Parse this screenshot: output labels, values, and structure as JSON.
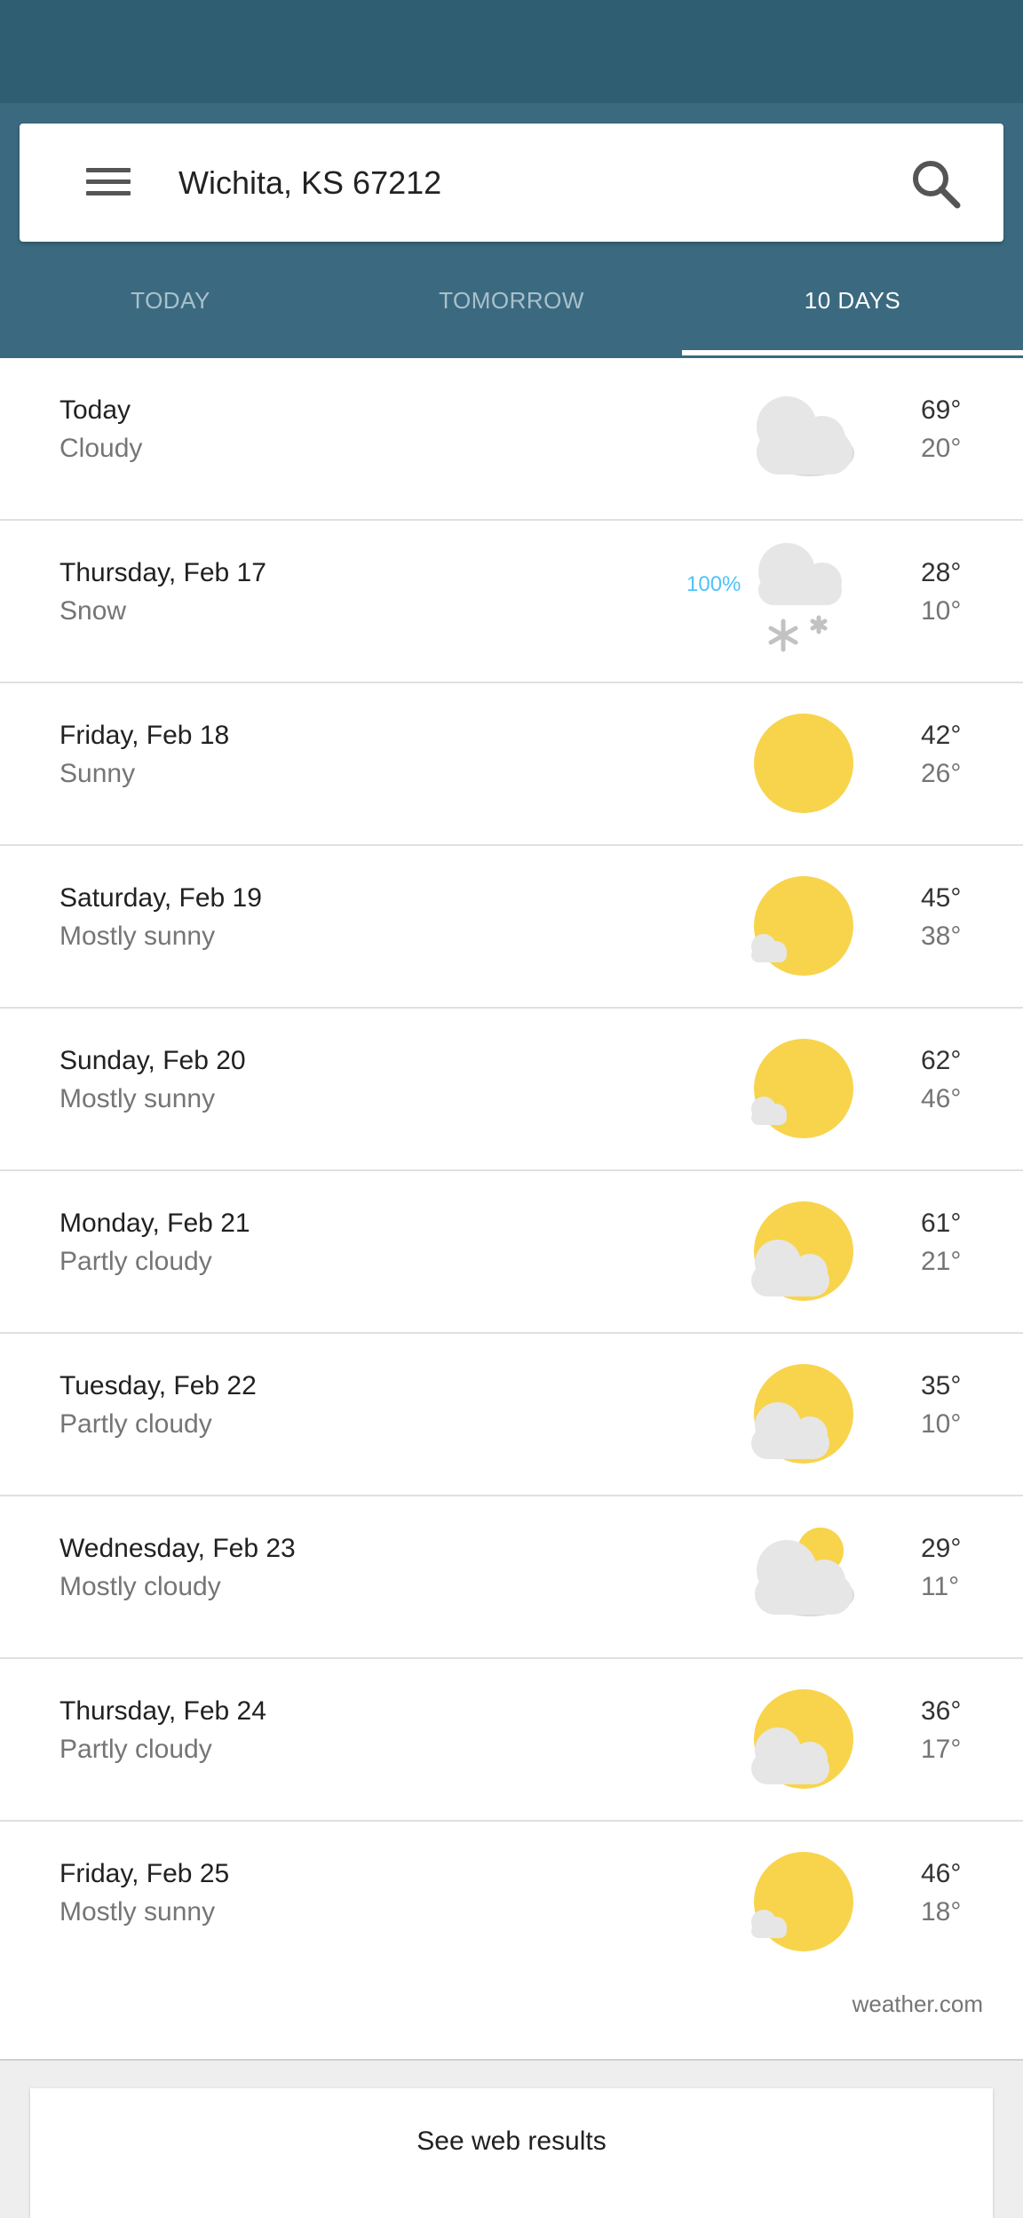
{
  "search": {
    "location": "Wichita, KS 67212"
  },
  "tabs": [
    {
      "label": "TODAY",
      "active": false
    },
    {
      "label": "TOMORROW",
      "active": false
    },
    {
      "label": "10 DAYS",
      "active": true
    }
  ],
  "forecast": [
    {
      "day": "Today",
      "condition": "Cloudy",
      "high": "69°",
      "low": "20°",
      "icon": "cloudy-icon"
    },
    {
      "day": "Thursday, Feb 17",
      "condition": "Snow",
      "high": "28°",
      "low": "10°",
      "precip": "100%",
      "icon": "snow-icon"
    },
    {
      "day": "Friday, Feb 18",
      "condition": "Sunny",
      "high": "42°",
      "low": "26°",
      "icon": "sunny-icon"
    },
    {
      "day": "Saturday, Feb 19",
      "condition": "Mostly sunny",
      "high": "45°",
      "low": "38°",
      "icon": "mostly-sunny-icon"
    },
    {
      "day": "Sunday, Feb 20",
      "condition": "Mostly sunny",
      "high": "62°",
      "low": "46°",
      "icon": "mostly-sunny-icon"
    },
    {
      "day": "Monday, Feb 21",
      "condition": "Partly cloudy",
      "high": "61°",
      "low": "21°",
      "icon": "partly-cloudy-icon"
    },
    {
      "day": "Tuesday, Feb 22",
      "condition": "Partly cloudy",
      "high": "35°",
      "low": "10°",
      "icon": "partly-cloudy-icon"
    },
    {
      "day": "Wednesday, Feb 23",
      "condition": "Mostly cloudy",
      "high": "29°",
      "low": "11°",
      "icon": "mostly-cloudy-icon"
    },
    {
      "day": "Thursday, Feb 24",
      "condition": "Partly cloudy",
      "high": "36°",
      "low": "17°",
      "icon": "partly-cloudy-icon"
    },
    {
      "day": "Friday, Feb 25",
      "condition": "Mostly sunny",
      "high": "46°",
      "low": "18°",
      "icon": "mostly-sunny-icon"
    }
  ],
  "source": "weather.com",
  "web_results_label": "See web results",
  "colors": {
    "status_bar": "#2f5e73",
    "header": "#3b6a80",
    "precip": "#4fc3f7",
    "sun": "#f8d44c"
  }
}
